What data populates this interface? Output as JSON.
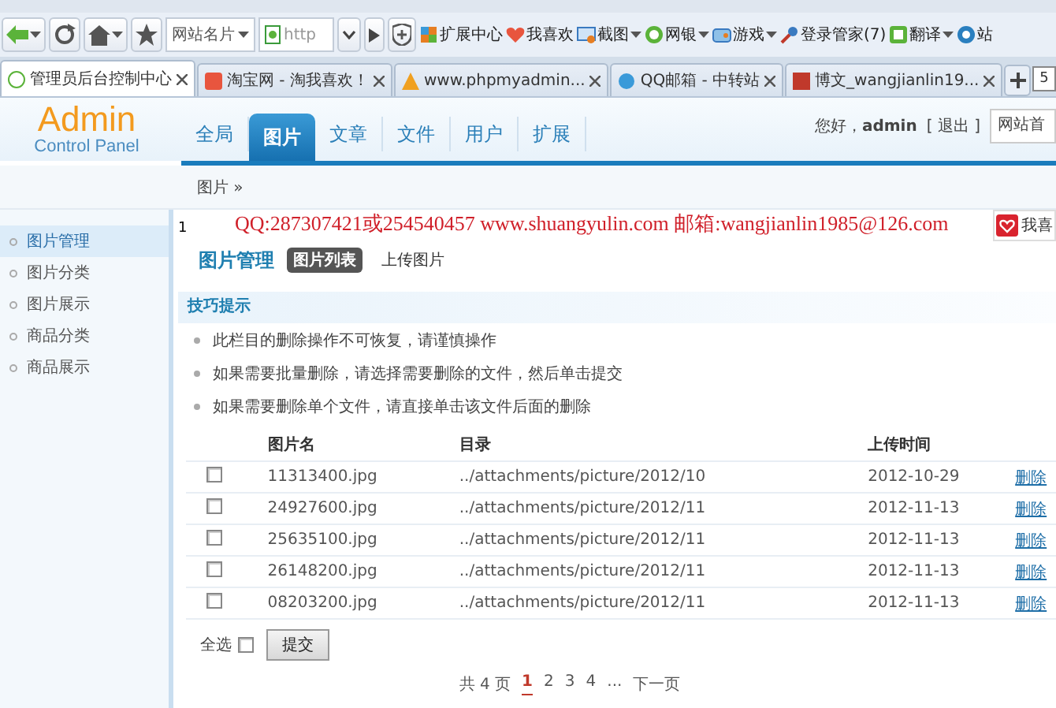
{
  "browser": {
    "toolbar": {
      "site_card": "网站名片",
      "address": {
        "value": "http"
      },
      "items": [
        {
          "label": "扩展中心",
          "dropdown": false
        },
        {
          "label": "我喜欢",
          "dropdown": false
        },
        {
          "label": "截图",
          "dropdown": true
        },
        {
          "label": "网银",
          "dropdown": true
        },
        {
          "label": "游戏",
          "dropdown": true
        },
        {
          "label": "登录管家(7)",
          "dropdown": false
        },
        {
          "label": "翻译",
          "dropdown": true
        },
        {
          "label": "站",
          "dropdown": false
        }
      ]
    },
    "tabs": [
      {
        "label": "管理员后台控制中心",
        "selected": true
      },
      {
        "label": "淘宝网 - 淘我喜欢！",
        "selected": false
      },
      {
        "label": "www.phpmyadmin...",
        "selected": false
      },
      {
        "label": "QQ邮箱 - 中转站",
        "selected": false
      },
      {
        "label": "博文_wangjianlin19...",
        "selected": false
      }
    ],
    "tab_count": "5"
  },
  "header": {
    "logo": {
      "title": "Admin",
      "subtitle": "Control Panel"
    },
    "nav": [
      {
        "label": "全局",
        "selected": false
      },
      {
        "label": "图片",
        "selected": true
      },
      {
        "label": "文章",
        "selected": false
      },
      {
        "label": "文件",
        "selected": false
      },
      {
        "label": "用户",
        "selected": false
      },
      {
        "label": "扩展",
        "selected": false
      }
    ],
    "greeting": "您好，**admin**",
    "logout": "[ 退出 ]",
    "site_field": {
      "value": "网站首"
    }
  },
  "breadcrumb": "图片 »",
  "sidebar": {
    "items": [
      {
        "label": "图片管理",
        "selected": true
      },
      {
        "label": "图片分类",
        "selected": false
      },
      {
        "label": "图片展示",
        "selected": false
      },
      {
        "label": "商品分类",
        "selected": false
      },
      {
        "label": "商品展示",
        "selected": false
      }
    ]
  },
  "content": {
    "line_number": "1",
    "contact": "QQ:287307421或254540457 www.shuangyulin.com 邮箱:wangjianlin1985@126.com",
    "like_button": "我喜",
    "title": "图片管理",
    "subtabs": [
      {
        "label": "图片列表",
        "selected": true
      },
      {
        "label": "上传图片",
        "selected": false
      }
    ],
    "tips": {
      "title": "技巧提示",
      "items": [
        "此栏目的删除操作不可恢复，请谨慎操作",
        "如果需要批量删除，请选择需要删除的文件，然后单击提交",
        "如果需要删除单个文件，请直接单击该文件后面的删除"
      ]
    },
    "table": {
      "columns": [
        "图片名",
        "目录",
        "上传时间"
      ],
      "rows": [
        {
          "checked": false,
          "name": "11313400.jpg",
          "directory": "../attachments/picture/2012/10",
          "date": "2012-10-29",
          "action": "删除"
        },
        {
          "checked": false,
          "name": "24927600.jpg",
          "directory": "../attachments/picture/2012/11",
          "date": "2012-11-13",
          "action": "删除"
        },
        {
          "checked": false,
          "name": "25635100.jpg",
          "directory": "../attachments/picture/2012/11",
          "date": "2012-11-13",
          "action": "删除"
        },
        {
          "checked": false,
          "name": "26148200.jpg",
          "directory": "../attachments/picture/2012/11",
          "date": "2012-11-13",
          "action": "删除"
        },
        {
          "checked": false,
          "name": "08203200.jpg",
          "directory": "../attachments/picture/2012/11",
          "date": "2012-11-13",
          "action": "删除"
        }
      ]
    },
    "select_all": {
      "label": "全选",
      "checked": false
    },
    "submit": "提交",
    "pagination": {
      "total": "共 4 页",
      "pages": [
        {
          "label": "1",
          "selected": true
        },
        {
          "label": "2",
          "selected": false
        },
        {
          "label": "3",
          "selected": false
        },
        {
          "label": "4",
          "selected": false
        }
      ],
      "ellipsis": "...",
      "next": "下一页"
    }
  }
}
